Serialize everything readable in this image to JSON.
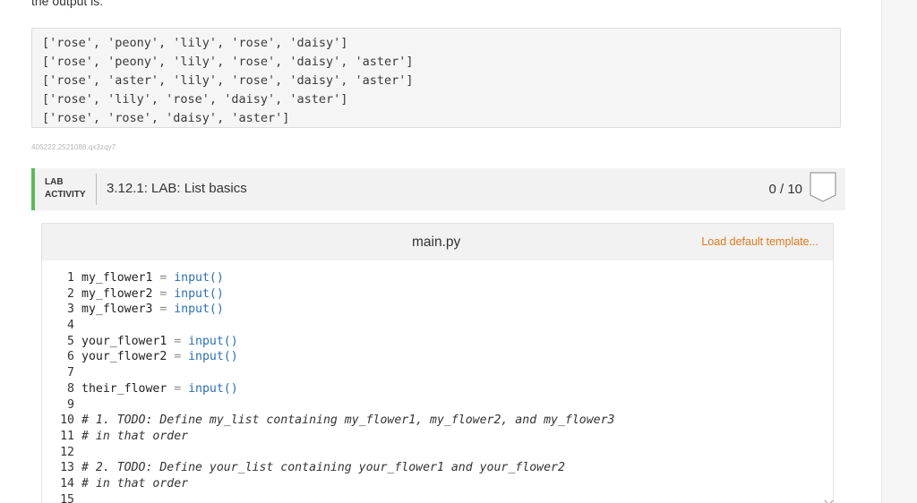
{
  "intro": "the output is:",
  "output_lines": [
    "['rose', 'peony', 'lily', 'rose', 'daisy']",
    "['rose', 'peony', 'lily', 'rose', 'daisy', 'aster']",
    "['rose', 'aster', 'lily', 'rose', 'daisy', 'aster']",
    "['rose', 'lily', 'rose', 'daisy', 'aster']",
    "['rose', 'rose', 'daisy', 'aster']"
  ],
  "zybooks_id": "405222.2521088.qx3zqy7",
  "lab": {
    "tag_line1": "LAB",
    "tag_line2": "ACTIVITY",
    "title": "3.12.1: LAB: List basics",
    "score": "0 / 10",
    "accent_color": "#5cb85c"
  },
  "editor": {
    "file_name": "main.py",
    "load_template_label": "Load default template...",
    "lines": [
      {
        "n": "1",
        "var": "my_flower1",
        "call": "input()"
      },
      {
        "n": "2",
        "var": "my_flower2",
        "call": "input()"
      },
      {
        "n": "3",
        "var": "my_flower3",
        "call": "input()"
      },
      {
        "n": "4"
      },
      {
        "n": "5",
        "var": "your_flower1",
        "call": "input()"
      },
      {
        "n": "6",
        "var": "your_flower2",
        "call": "input()"
      },
      {
        "n": "7"
      },
      {
        "n": "8",
        "var": "their_flower",
        "call": "input()"
      },
      {
        "n": "9"
      },
      {
        "n": "10",
        "comment": "# 1. TODO: Define my_list containing my_flower1, my_flower2, and my_flower3"
      },
      {
        "n": "11",
        "comment": "# in that order"
      },
      {
        "n": "12"
      },
      {
        "n": "13",
        "comment": "# 2. TODO: Define your_list containing your_flower1 and your_flower2"
      },
      {
        "n": "14",
        "comment": "# in that order"
      },
      {
        "n": "15"
      }
    ]
  }
}
